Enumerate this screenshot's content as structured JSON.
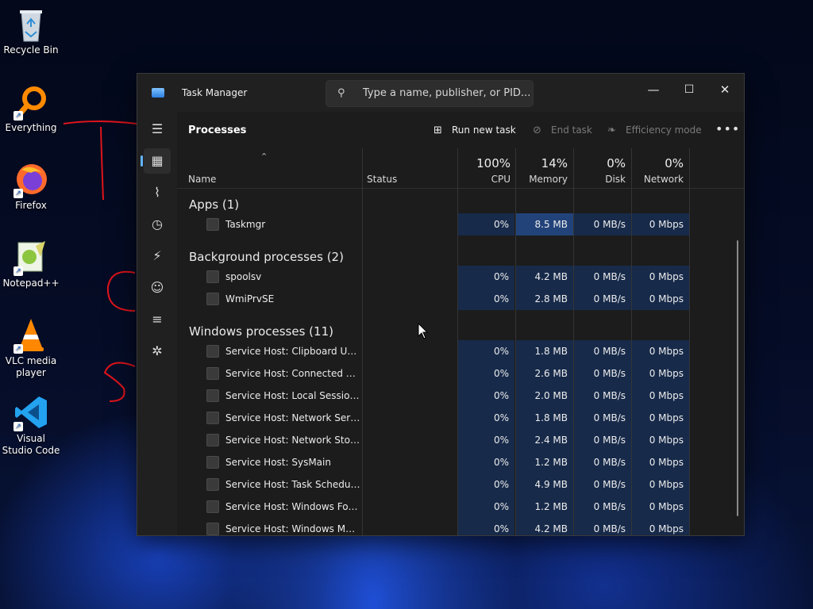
{
  "desktop": {
    "icons": [
      {
        "label": "Recycle Bin",
        "icon": "recycle-bin-icon"
      },
      {
        "label": "Everything",
        "icon": "everything-search-icon"
      },
      {
        "label": "Firefox",
        "icon": "firefox-icon"
      },
      {
        "label": "Notepad++",
        "icon": "notepad-plus-plus-icon"
      },
      {
        "label": "VLC media player",
        "icon": "vlc-icon"
      },
      {
        "label": "Visual Studio Code",
        "icon": "vscode-icon"
      }
    ]
  },
  "window": {
    "title": "Task Manager",
    "search_placeholder": "Type a name, publisher, or PID...",
    "controls": {
      "minimize": "—",
      "maximize": "☐",
      "close": "✕"
    }
  },
  "toolbar": {
    "page_title": "Processes",
    "run_new_task": "Run new task",
    "end_task": "End task",
    "efficiency_mode": "Efficiency mode",
    "more": "•••"
  },
  "table": {
    "headers": {
      "name": "Name",
      "status": "Status",
      "cpu_pct": "100%",
      "cpu": "CPU",
      "memory_pct": "14%",
      "memory": "Memory",
      "disk_pct": "0%",
      "disk": "Disk",
      "network_pct": "0%",
      "network": "Network"
    },
    "groups": [
      {
        "label": "Apps (1)"
      },
      {
        "label": "Background processes (2)"
      },
      {
        "label": "Windows processes (11)"
      }
    ],
    "rows": [
      {
        "name": "Taskmgr",
        "cpu": "0%",
        "memory": "8.5 MB",
        "disk": "0 MB/s",
        "network": "0 Mbps"
      },
      {
        "name": "spoolsv",
        "cpu": "0%",
        "memory": "4.2 MB",
        "disk": "0 MB/s",
        "network": "0 Mbps"
      },
      {
        "name": "WmiPrvSE",
        "cpu": "0%",
        "memory": "2.8 MB",
        "disk": "0 MB/s",
        "network": "0 Mbps"
      },
      {
        "name": "Service Host: Clipboard User S...",
        "cpu": "0%",
        "memory": "1.8 MB",
        "disk": "0 MB/s",
        "network": "0 Mbps"
      },
      {
        "name": "Service Host: Connected Devi...",
        "cpu": "0%",
        "memory": "2.6 MB",
        "disk": "0 MB/s",
        "network": "0 Mbps"
      },
      {
        "name": "Service Host: Local Session M...",
        "cpu": "0%",
        "memory": "2.0 MB",
        "disk": "0 MB/s",
        "network": "0 Mbps"
      },
      {
        "name": "Service Host: Network Service",
        "cpu": "0%",
        "memory": "1.8 MB",
        "disk": "0 MB/s",
        "network": "0 Mbps"
      },
      {
        "name": "Service Host: Network Store In...",
        "cpu": "0%",
        "memory": "2.4 MB",
        "disk": "0 MB/s",
        "network": "0 Mbps"
      },
      {
        "name": "Service Host: SysMain",
        "cpu": "0%",
        "memory": "1.2 MB",
        "disk": "0 MB/s",
        "network": "0 Mbps"
      },
      {
        "name": "Service Host: Task Scheduler",
        "cpu": "0%",
        "memory": "4.9 MB",
        "disk": "0 MB/s",
        "network": "0 Mbps"
      },
      {
        "name": "Service Host: Windows Font C...",
        "cpu": "0%",
        "memory": "1.2 MB",
        "disk": "0 MB/s",
        "network": "0 Mbps"
      },
      {
        "name": "Service Host: Windows Manag...",
        "cpu": "0%",
        "memory": "4.2 MB",
        "disk": "0 MB/s",
        "network": "0 Mbps"
      }
    ]
  },
  "sidebar": {
    "items": [
      "hamburger-menu-icon",
      "processes-icon",
      "performance-icon",
      "app-history-icon",
      "startup-apps-icon",
      "users-icon",
      "details-icon",
      "services-icon"
    ],
    "settings": "settings-icon"
  },
  "colors": {
    "accent": "#63b3ff",
    "annotation": "#e0141b",
    "heat_low": "#172a4a",
    "heat_mid": "#22437a"
  }
}
